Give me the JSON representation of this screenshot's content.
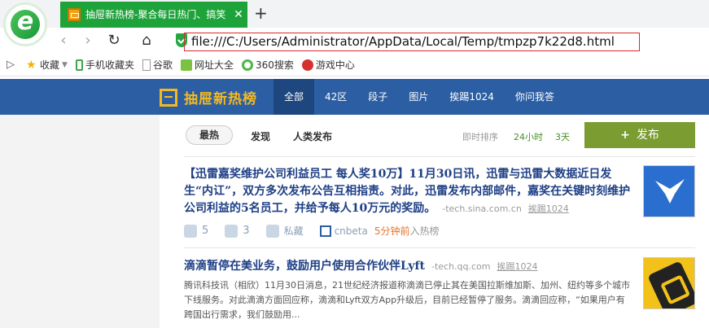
{
  "browser": {
    "logo_letter": "e",
    "tab_title": "抽屉新热榜-聚合每日热门、搞笑",
    "tab_close": "✕",
    "new_tab": "+",
    "url": "file:///C:/Users/Administrator/AppData/Local/Temp/tmpzp7k22d8.html",
    "bookmarks": [
      {
        "label": "收藏",
        "icon": "star-icon"
      },
      {
        "label": "手机收藏夹",
        "icon": "phone-icon"
      },
      {
        "label": "谷歌",
        "icon": "page-icon"
      },
      {
        "label": "网址大全",
        "icon": "sites-icon"
      },
      {
        "label": "360搜索",
        "icon": "search360-icon"
      },
      {
        "label": "游戏中心",
        "icon": "game-icon"
      }
    ]
  },
  "site": {
    "logo_text": "抽屉新热榜",
    "nav": [
      "全部",
      "42区",
      "段子",
      "图片",
      "挨踢1024",
      "你问我答"
    ],
    "subnav": {
      "hot": "最热",
      "discover": "发现",
      "human": "人类发布",
      "realtime": "即时排序",
      "h24": "24小时",
      "d3": "3天",
      "publish": "发布"
    },
    "items": [
      {
        "title": "【迅雷嘉奖维护公司利益员工 每人奖10万】11月30日讯，迅雷与迅雷大数据近日发生“内讧”，双方多次发布公告互相指责。对此，迅雷发布内部邮件，嘉奖在关键时刻维护公司利益的5名员工，并给予每人10万元的奖励。",
        "source": "-tech.sina.com.cn",
        "author": "挨踢1024",
        "likes": "5",
        "comments": "3",
        "private": "私藏",
        "channel": "cnbeta",
        "time": "5分钟前",
        "time_suffix": "入热榜"
      },
      {
        "title": "滴滴暂停在美业务，鼓励用户使用合作伙伴Lyft",
        "source": "-tech.qq.com",
        "author": "挨踢1024",
        "summary": "腾讯科技讯（相欣）11月30日消息，21世纪经济报道称滴滴已停止其在美国拉斯维加斯、加州、纽约等多个城市下线服务。对此滴滴方面回应称，滴滴和Lyft双方App升级后，目前已经暂停了服务。滴滴回应称，“如果用户有跨国出行需求，我们鼓励用..."
      }
    ]
  }
}
